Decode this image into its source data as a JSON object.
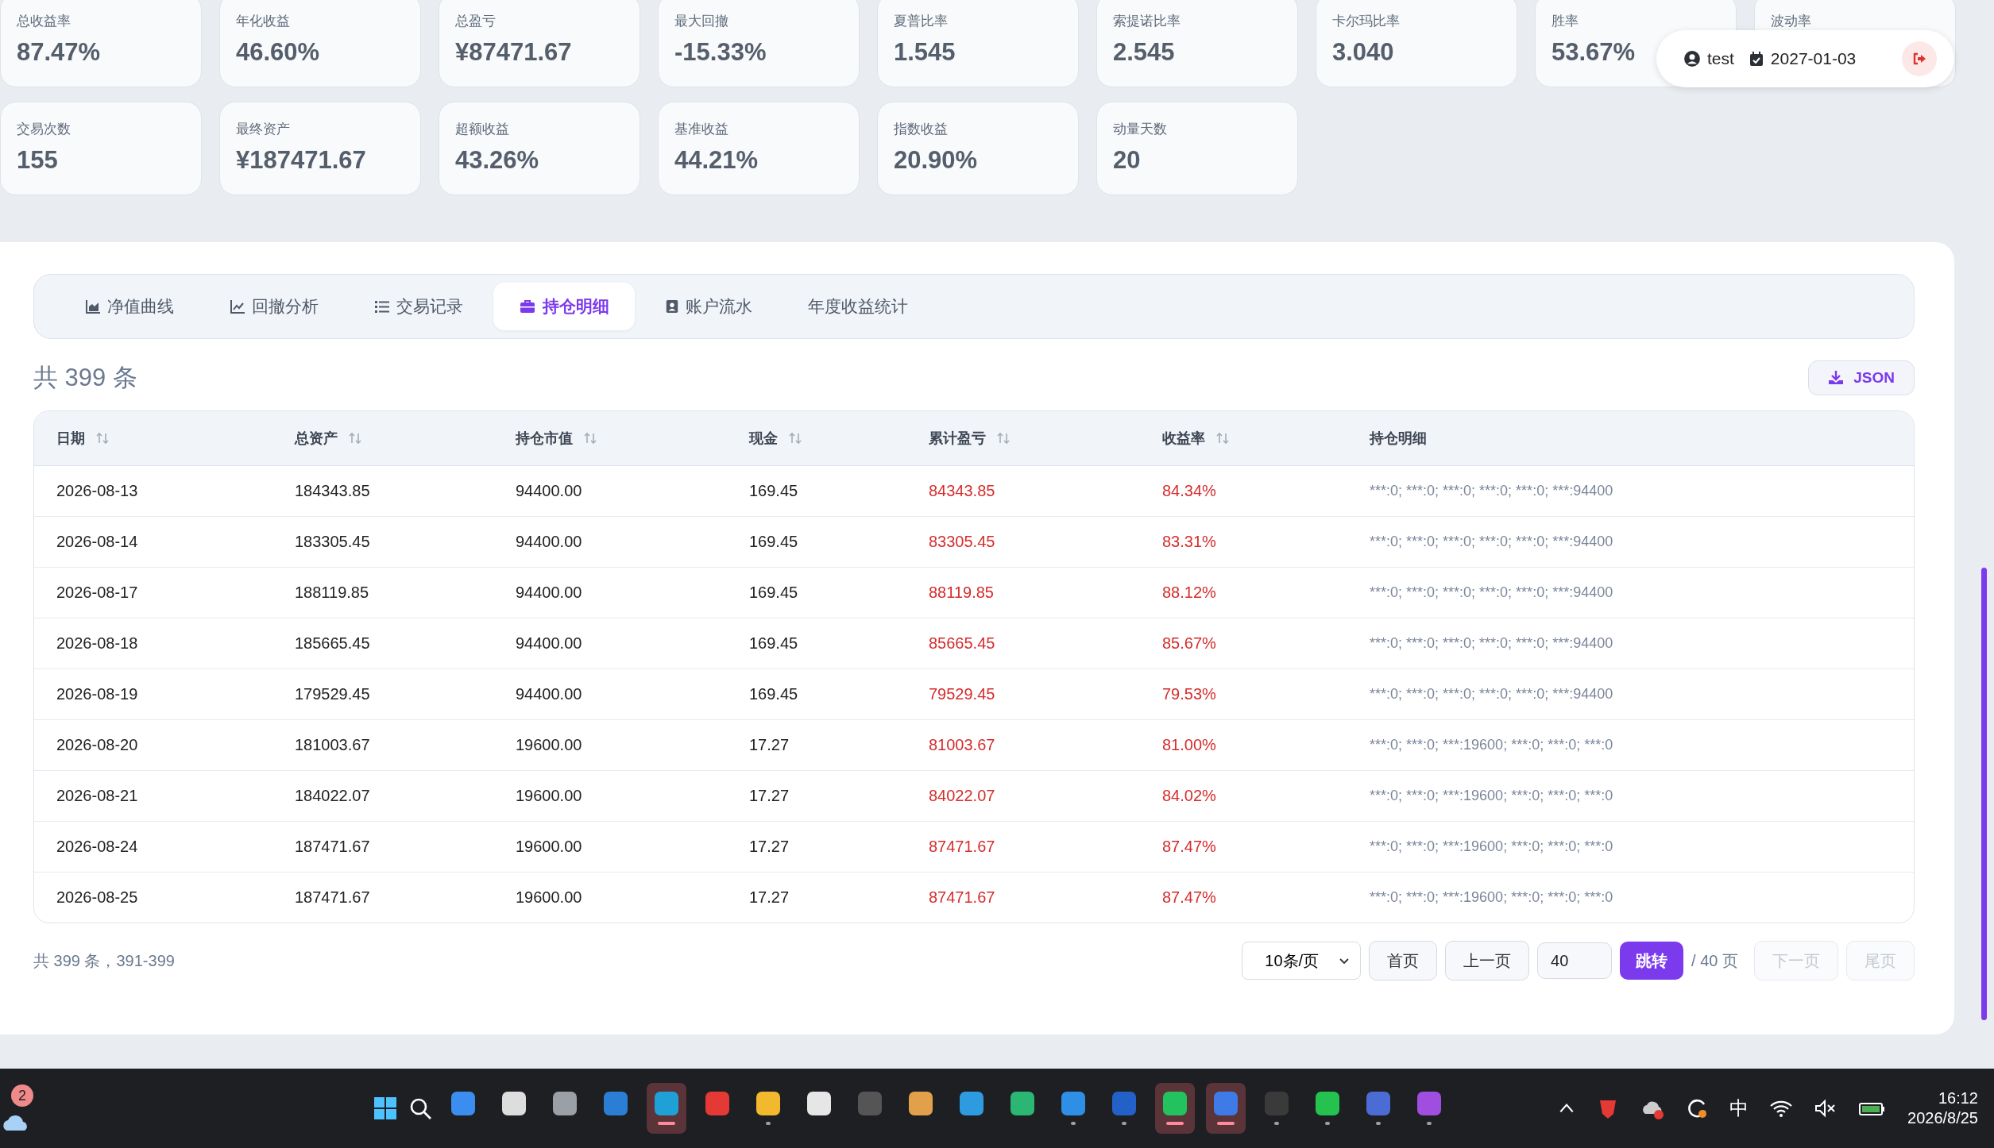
{
  "stats_rows": [
    [
      {
        "label": "总收益率",
        "value": "87.47%"
      },
      {
        "label": "年化收益",
        "value": "46.60%"
      },
      {
        "label": "总盈亏",
        "value": "¥87471.67"
      },
      {
        "label": "最大回撤",
        "value": "-15.33%"
      },
      {
        "label": "夏普比率",
        "value": "1.545"
      },
      {
        "label": "索提诺比率",
        "value": "2.545"
      },
      {
        "label": "卡尔玛比率",
        "value": "3.040"
      },
      {
        "label": "胜率",
        "value": "53.67%"
      },
      {
        "label": "波动率"
      }
    ],
    [
      {
        "label": "交易次数",
        "value": "155"
      },
      {
        "label": "最终资产",
        "value": "¥187471.67"
      },
      {
        "label": "超额收益",
        "value": "43.26%"
      },
      {
        "label": "基准收益",
        "value": "44.21%"
      },
      {
        "label": "指数收益",
        "value": "20.90%"
      },
      {
        "label": "动量天数",
        "value": "20"
      }
    ]
  ],
  "user_badge": {
    "user": "test",
    "date": "2027-01-03"
  },
  "tabs": [
    {
      "label": "净值曲线",
      "kind": "area",
      "selected": false
    },
    {
      "label": "回撤分析",
      "kind": "line",
      "selected": false
    },
    {
      "label": "交易记录",
      "kind": "list",
      "selected": false
    },
    {
      "label": "持仓明细",
      "kind": "briefcase",
      "selected": true
    },
    {
      "label": "账户流水",
      "kind": "contact",
      "selected": false
    },
    {
      "label": "年度收益统计",
      "kind": "none",
      "selected": false
    }
  ],
  "total": "共 399 条",
  "export_button": "JSON",
  "table": {
    "columns": [
      {
        "label": "日期",
        "sortable": true,
        "kind": "text"
      },
      {
        "label": "总资产",
        "sortable": true,
        "kind": "text"
      },
      {
        "label": "持仓市值",
        "sortable": true,
        "kind": "text"
      },
      {
        "label": "现金",
        "sortable": true,
        "kind": "text"
      },
      {
        "label": "累计盈亏",
        "sortable": true,
        "kind": "gain"
      },
      {
        "label": "收益率",
        "sortable": true,
        "kind": "gain"
      },
      {
        "label": "持仓明细",
        "sortable": false,
        "kind": "detail"
      }
    ],
    "rows": [
      [
        "2026-08-13",
        "184343.85",
        "94400.00",
        "169.45",
        "84343.85",
        "84.34%",
        "***:0; ***:0; ***:0; ***:0; ***:0; ***:94400"
      ],
      [
        "2026-08-14",
        "183305.45",
        "94400.00",
        "169.45",
        "83305.45",
        "83.31%",
        "***:0; ***:0; ***:0; ***:0; ***:0; ***:94400"
      ],
      [
        "2026-08-17",
        "188119.85",
        "94400.00",
        "169.45",
        "88119.85",
        "88.12%",
        "***:0; ***:0; ***:0; ***:0; ***:0; ***:94400"
      ],
      [
        "2026-08-18",
        "185665.45",
        "94400.00",
        "169.45",
        "85665.45",
        "85.67%",
        "***:0; ***:0; ***:0; ***:0; ***:0; ***:94400"
      ],
      [
        "2026-08-19",
        "179529.45",
        "94400.00",
        "169.45",
        "79529.45",
        "79.53%",
        "***:0; ***:0; ***:0; ***:0; ***:0; ***:94400"
      ],
      [
        "2026-08-20",
        "181003.67",
        "19600.00",
        "17.27",
        "81003.67",
        "81.00%",
        "***:0; ***:0; ***:19600; ***:0; ***:0; ***:0"
      ],
      [
        "2026-08-21",
        "184022.07",
        "19600.00",
        "17.27",
        "84022.07",
        "84.02%",
        "***:0; ***:0; ***:19600; ***:0; ***:0; ***:0"
      ],
      [
        "2026-08-24",
        "187471.67",
        "19600.00",
        "17.27",
        "87471.67",
        "87.47%",
        "***:0; ***:0; ***:19600; ***:0; ***:0; ***:0"
      ],
      [
        "2026-08-25",
        "187471.67",
        "19600.00",
        "17.27",
        "87471.67",
        "87.47%",
        "***:0; ***:0; ***:19600; ***:0; ***:0; ***:0"
      ]
    ]
  },
  "pagination": {
    "summary": "共 399 条，391-399",
    "page_size": "10条/页",
    "buttons": [
      {
        "label": "首页",
        "disabled": false
      },
      {
        "label": "上一页",
        "disabled": false
      }
    ],
    "page_input": "40",
    "go_button": "跳转",
    "page_count": "/ 40 页",
    "after_buttons": [
      {
        "label": "下一页",
        "disabled": true
      },
      {
        "label": "尾页",
        "disabled": true
      }
    ]
  },
  "taskbar": {
    "weather_badge": "2",
    "apps": [
      {
        "color": "#3b8ef0",
        "running": false,
        "selected": false
      },
      {
        "color": "#dddddd",
        "running": false,
        "selected": false
      },
      {
        "color": "#9aa0a6",
        "running": false,
        "selected": false
      },
      {
        "color": "#2a7fd4",
        "running": false,
        "selected": false
      },
      {
        "color": "#1fa1d8",
        "running": true,
        "selected": true
      },
      {
        "color": "#e53935",
        "running": false,
        "selected": false
      },
      {
        "color": "#f2b92e",
        "running": true,
        "selected": false
      },
      {
        "color": "#e6e6e6",
        "running": false,
        "selected": false
      },
      {
        "color": "#555555",
        "running": false,
        "selected": false
      },
      {
        "color": "#e3a04a",
        "running": false,
        "selected": false
      },
      {
        "color": "#2e9be0",
        "running": false,
        "selected": false
      },
      {
        "color": "#2bb673",
        "running": false,
        "selected": false
      },
      {
        "color": "#2f8fe6",
        "running": true,
        "selected": false
      },
      {
        "color": "#2361c9",
        "running": true,
        "selected": false
      },
      {
        "color": "#22c35e",
        "running": true,
        "selected": true
      },
      {
        "color": "#3f7be6",
        "running": true,
        "selected": true
      },
      {
        "color": "#3a3a3a",
        "running": true,
        "selected": false
      },
      {
        "color": "#26c24f",
        "running": true,
        "selected": false
      },
      {
        "color": "#4a6cd4",
        "running": true,
        "selected": false
      },
      {
        "color": "#a04ee0",
        "running": true,
        "selected": false
      }
    ],
    "ime": "中",
    "time": "16:12",
    "date": "2026/8/25"
  }
}
